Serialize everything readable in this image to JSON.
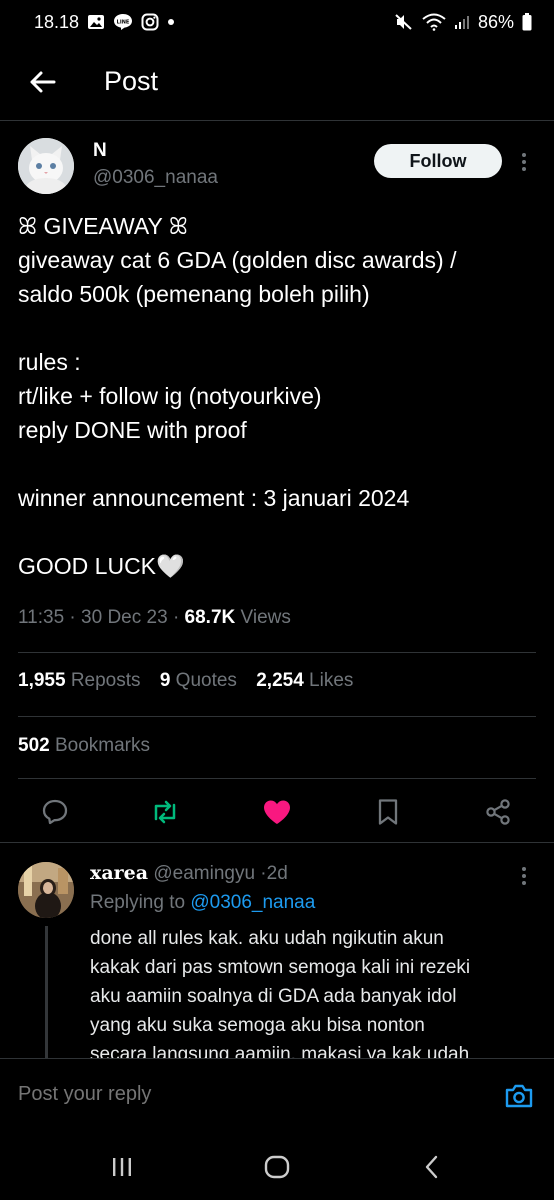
{
  "status_bar": {
    "time": "18.18",
    "battery": "86%"
  },
  "header": {
    "title": "Post"
  },
  "post": {
    "author_name": "N",
    "author_handle": "@0306_nanaa",
    "follow_label": "Follow",
    "lines": [
      "ꕤ GIVEAWAY ꕤ",
      "giveaway cat 6 GDA (golden disc awards) /",
      "saldo 500k (pemenang boleh pilih)",
      "",
      "rules :",
      "rt/like + follow ig (notyourkive)",
      "reply DONE with proof",
      "",
      "winner announcement : 3 januari 2024",
      "",
      "GOOD LUCK🤍"
    ],
    "time": "11:35",
    "date": "30 Dec 23",
    "views_count": "68.7K",
    "views_label": "Views",
    "reposts_count": "1,955",
    "reposts_label": "Reposts",
    "quotes_count": "9",
    "quotes_label": "Quotes",
    "likes_count": "2,254",
    "likes_label": "Likes",
    "bookmarks_count": "502",
    "bookmarks_label": "Bookmarks"
  },
  "actions": {
    "reply_icon": "comment-icon",
    "repost_icon": "repost-icon",
    "like_icon": "heart-icon",
    "bookmark_icon": "bookmark-icon",
    "share_icon": "share-icon",
    "repost_color": "#00ba7c",
    "like_color": "#f91880"
  },
  "reply": {
    "name": "xarea",
    "handle": "@eamingyu",
    "age": "2d",
    "replying_to_label": "Replying to",
    "replying_to_handle": "@0306_nanaa",
    "lines": [
      "done all rules kak. aku udah ngikutin akun",
      "kakak dari pas smtown semoga kali ini rezeki",
      "aku aamiin soalnya di GDA ada banyak idol",
      "yang aku suka semoga aku bisa nonton",
      "secara langsung aamiin, makasi ya kak udah"
    ]
  },
  "reply_bar": {
    "placeholder": "Post your reply"
  },
  "colors": {
    "link": "#1d9bf0",
    "muted": "#71767b",
    "divider": "#2f3336"
  }
}
